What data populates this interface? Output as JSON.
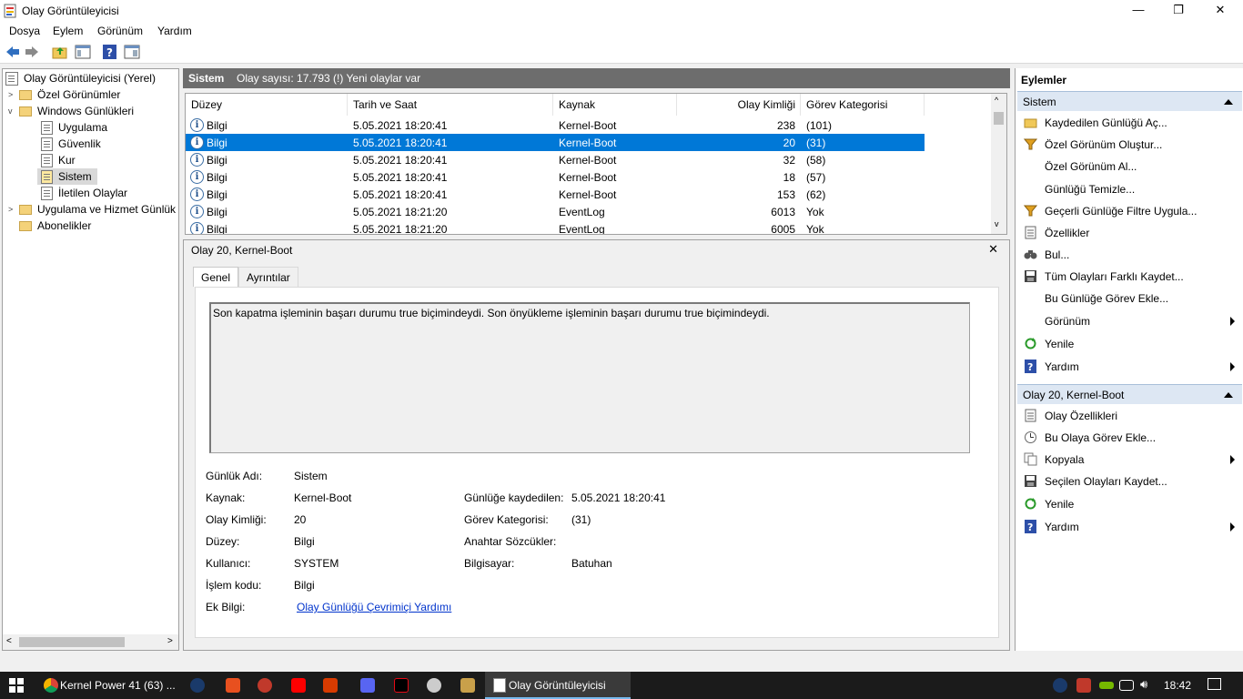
{
  "window": {
    "title": "Olay Görüntüleyicisi",
    "minimize": "—",
    "maximize": "❐",
    "close": "✕"
  },
  "menu": [
    "Dosya",
    "Eylem",
    "Görünüm",
    "Yardım"
  ],
  "tree": {
    "root": "Olay Görüntüleyicisi (Yerel)",
    "custom_views": "Özel Görünümler",
    "windows_logs": "Windows Günlükleri",
    "app": "Uygulama",
    "security": "Güvenlik",
    "setup": "Kur",
    "system": "Sistem",
    "forwarded": "İletilen Olaylar",
    "app_service": "Uygulama ve Hizmet Günlük",
    "subscriptions": "Abonelikler"
  },
  "header": {
    "name": "Sistem",
    "count": "Olay sayısı: 17.793 (!) Yeni olaylar var"
  },
  "grid": {
    "columns": [
      "Düzey",
      "Tarih ve Saat",
      "Kaynak",
      "Olay Kimliği",
      "Görev Kategorisi"
    ],
    "rows": [
      {
        "level": "Bilgi",
        "date": "5.05.2021 18:20:41",
        "source": "Kernel-Boot",
        "id": "238",
        "category": "(101)"
      },
      {
        "level": "Bilgi",
        "date": "5.05.2021 18:20:41",
        "source": "Kernel-Boot",
        "id": "20",
        "category": "(31)"
      },
      {
        "level": "Bilgi",
        "date": "5.05.2021 18:20:41",
        "source": "Kernel-Boot",
        "id": "32",
        "category": "(58)"
      },
      {
        "level": "Bilgi",
        "date": "5.05.2021 18:20:41",
        "source": "Kernel-Boot",
        "id": "18",
        "category": "(57)"
      },
      {
        "level": "Bilgi",
        "date": "5.05.2021 18:20:41",
        "source": "Kernel-Boot",
        "id": "153",
        "category": "(62)"
      },
      {
        "level": "Bilgi",
        "date": "5.05.2021 18:21:20",
        "source": "EventLog",
        "id": "6013",
        "category": "Yok"
      },
      {
        "level": "Bilgi",
        "date": "5.05.2021 18:21:20",
        "source": "EventLog",
        "id": "6005",
        "category": "Yok"
      }
    ]
  },
  "detail": {
    "title": "Olay 20, Kernel-Boot",
    "tabs": [
      "Genel",
      "Ayrıntılar"
    ],
    "description": "Son kapatma işleminin başarı durumu true biçimindeydi. Son önyükleme işleminin başarı durumu true biçimindeydi.",
    "labels": {
      "log_name": "Günlük Adı:",
      "source": "Kaynak:",
      "event_id": "Olay Kimliği:",
      "level": "Düzey:",
      "user": "Kullanıcı:",
      "opcode": "İşlem kodu:",
      "more_info": "Ek Bilgi:",
      "logged": "Günlüğe kaydedilen:",
      "task_category": "Görev Kategorisi:",
      "keywords": "Anahtar Sözcükler:",
      "computer": "Bilgisayar:"
    },
    "values": {
      "log_name": "Sistem",
      "source": "Kernel-Boot",
      "event_id": "20",
      "level": "Bilgi",
      "user": "SYSTEM",
      "opcode": "Bilgi",
      "more_info": "Olay Günlüğü Çevrimiçi Yardımı",
      "logged": "5.05.2021 18:20:41",
      "task_category": "(31)",
      "keywords": "",
      "computer": "Batuhan"
    }
  },
  "actions": {
    "header": "Eylemler",
    "section1": "Sistem",
    "items1": [
      {
        "label": "Kaydedilen Günlüğü Aç...",
        "icon": "folder-open-icon"
      },
      {
        "label": "Özel Görünüm Oluştur...",
        "icon": "filter-icon"
      },
      {
        "label": "Özel Görünüm Al...",
        "icon": ""
      },
      {
        "label": "Günlüğü Temizle...",
        "icon": ""
      },
      {
        "label": "Geçerli Günlüğe Filtre Uygula...",
        "icon": "filter-icon"
      },
      {
        "label": "Özellikler",
        "icon": "properties-icon"
      },
      {
        "label": "Bul...",
        "icon": "binoculars-icon"
      },
      {
        "label": "Tüm Olayları Farklı Kaydet...",
        "icon": "save-icon"
      },
      {
        "label": "Bu Günlüğe Görev Ekle...",
        "icon": ""
      },
      {
        "label": "Görünüm",
        "icon": "",
        "submenu": true
      },
      {
        "label": "Yenile",
        "icon": "refresh-icon"
      },
      {
        "label": "Yardım",
        "icon": "help-icon",
        "submenu": true
      }
    ],
    "section2": "Olay 20, Kernel-Boot",
    "items2": [
      {
        "label": "Olay Özellikleri",
        "icon": "properties-icon"
      },
      {
        "label": "Bu Olaya Görev Ekle...",
        "icon": "task-icon"
      },
      {
        "label": "Kopyala",
        "icon": "copy-icon",
        "submenu": true
      },
      {
        "label": "Seçilen Olayları Kaydet...",
        "icon": "save-icon"
      },
      {
        "label": "Yenile",
        "icon": "refresh-icon"
      },
      {
        "label": "Yardım",
        "icon": "help-icon",
        "submenu": true
      }
    ]
  },
  "taskbar": {
    "chrome_task": "Kernel Power 41 (63) ...",
    "active_task": "Olay Görüntüleyicisi",
    "time": "18:42"
  }
}
